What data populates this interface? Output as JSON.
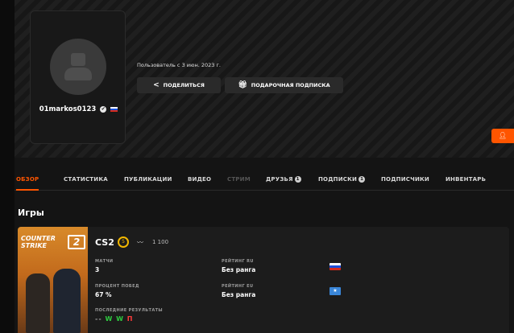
{
  "profile": {
    "username": "01markos0123",
    "member_since": "Пользователь с 3 июн. 2023 г."
  },
  "actions": {
    "share_label": "ПОДЕЛИТЬСЯ",
    "gift_label": "ПОДАРОЧНАЯ ПОДПИСКА"
  },
  "tabs": [
    {
      "label": "ОБЗОР",
      "active": true
    },
    {
      "label": "СТАТИСТИКА"
    },
    {
      "label": "ПУБЛИКАЦИИ"
    },
    {
      "label": "ВИДЕО"
    },
    {
      "label": "СТРИМ",
      "disabled": true
    },
    {
      "label": "ДРУЗЬЯ",
      "count": "1"
    },
    {
      "label": "ПОДПИСКИ",
      "count": "1"
    },
    {
      "label": "ПОДПИСЧИКИ"
    },
    {
      "label": "ИНВЕНТАРЬ"
    }
  ],
  "games_section": {
    "title": "Игры",
    "game": {
      "cover_logo": "COUNTER STRIKE",
      "cover_number": "2",
      "name": "CS2",
      "premier_level": "5",
      "elo": "1 100",
      "matches_label": "МАТЧИ",
      "matches_value": "3",
      "rating_ru_label": "РЕЙТИНГ RU",
      "rating_ru_value": "Без ранга",
      "winrate_label": "ПРОЦЕНТ ПОБЕД",
      "winrate_value": "67 %",
      "rating_eu_label": "РЕЙТИНГ EU",
      "rating_eu_value": "Без ранга",
      "recent_label": "ПОСЛЕДНИЕ РЕЗУЛЬТАТЫ",
      "recent_results": [
        "-",
        "-",
        "W",
        "W",
        "П"
      ]
    }
  },
  "colors": {
    "accent": "#ff5500",
    "win": "#2ecc40",
    "loss": "#ff3b3b"
  }
}
